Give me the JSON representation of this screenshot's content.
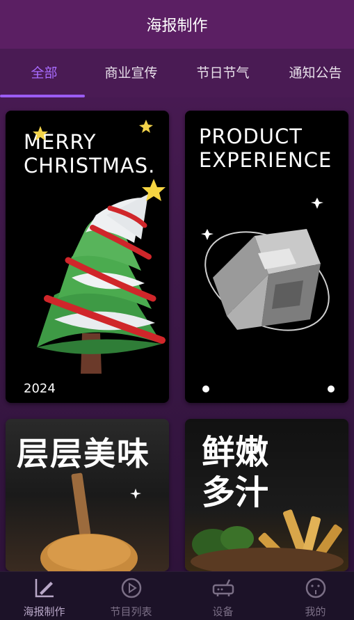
{
  "header": {
    "title": "海报制作"
  },
  "tabs": [
    {
      "label": "全部",
      "active": true
    },
    {
      "label": "商业宣传",
      "active": false
    },
    {
      "label": "节日节气",
      "active": false
    },
    {
      "label": "通知公告",
      "active": false
    }
  ],
  "cards": {
    "christmas": {
      "line1": "MERRY",
      "line2": "CHRISTMAS.",
      "year": "2024"
    },
    "product": {
      "line1": "PRODUCT",
      "line2": "EXPERIENCE"
    },
    "burger": {
      "title": "层层美味"
    },
    "fries": {
      "line1": "鲜嫩",
      "line2": "多汁"
    }
  },
  "bottom_nav": [
    {
      "label": "海报制作",
      "icon": "edit-chart-icon",
      "active": true
    },
    {
      "label": "节目列表",
      "icon": "play-circle-icon",
      "active": false
    },
    {
      "label": "设备",
      "icon": "router-device-icon",
      "active": false
    },
    {
      "label": "我的",
      "icon": "face-profile-icon",
      "active": false
    }
  ],
  "colors": {
    "accent": "#a96cff",
    "header_bg": "#5b1f63",
    "nav_bg": "#1c1228"
  }
}
